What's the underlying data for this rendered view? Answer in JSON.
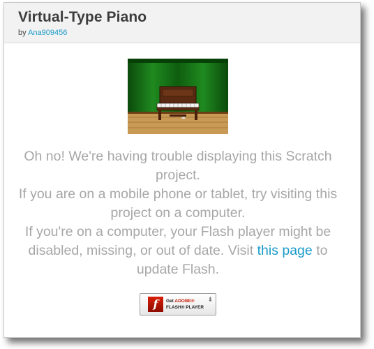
{
  "project": {
    "title": "Virtual-Type Piano",
    "by_prefix": "by",
    "author": "Ana909456"
  },
  "message": {
    "line1": "Oh no! We're having trouble displaying this Scratch project.",
    "line2": "If you are on a mobile phone or tablet, try visiting this project on a computer.",
    "line3_before_link": "If you're on a computer, your Flash player might be disabled, missing, or out of date. Visit",
    "link_text": "this page",
    "line3_after_link": "to update Flash."
  },
  "flash_button": {
    "get": "Get",
    "adobe": "ADOBE®",
    "product": "FLASH® PLAYER",
    "logo_glyph": "f",
    "icon": "download-arrow-icon"
  },
  "colors": {
    "link": "#1a9bc9",
    "message_text": "#a7a7a7",
    "header_bg": "#f2f2f2"
  }
}
